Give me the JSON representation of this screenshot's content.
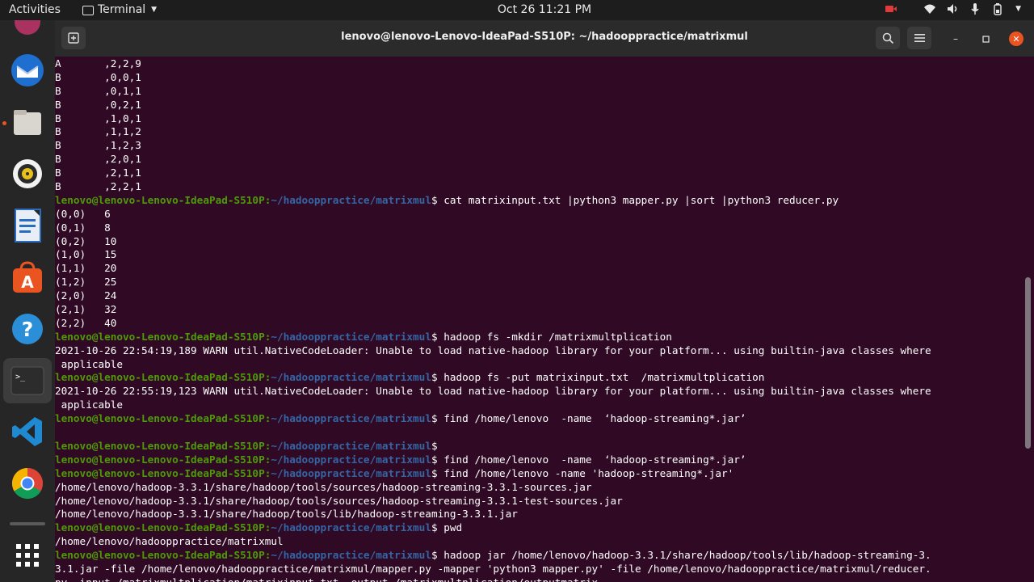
{
  "topbar": {
    "activities": "Activities",
    "app_name": "Terminal",
    "clock": "Oct 26  11:21 PM"
  },
  "dock": {
    "apps": [
      "thunderbird",
      "files",
      "rhythmbox",
      "writer",
      "software",
      "help",
      "terminal",
      "vscode",
      "chrome"
    ]
  },
  "window": {
    "title": "lenovo@lenovo-Lenovo-IdeaPad-S510P: ~/hadooppractice/matrixmul"
  },
  "terminal": {
    "prompt_user": "lenovo@lenovo-Lenovo-IdeaPad-S510P",
    "prompt_path": "~/hadooppractice/matrixmul",
    "prompt_dollar": "$",
    "lines": [
      {
        "type": "out",
        "text": "A       ,2,2,9"
      },
      {
        "type": "out",
        "text": "B       ,0,0,1"
      },
      {
        "type": "out",
        "text": "B       ,0,1,1"
      },
      {
        "type": "out",
        "text": "B       ,0,2,1"
      },
      {
        "type": "out",
        "text": "B       ,1,0,1"
      },
      {
        "type": "out",
        "text": "B       ,1,1,2"
      },
      {
        "type": "out",
        "text": "B       ,1,2,3"
      },
      {
        "type": "out",
        "text": "B       ,2,0,1"
      },
      {
        "type": "out",
        "text": "B       ,2,1,1"
      },
      {
        "type": "out",
        "text": "B       ,2,2,1"
      },
      {
        "type": "cmd",
        "text": " cat matrixinput.txt |python3 mapper.py |sort |python3 reducer.py"
      },
      {
        "type": "out",
        "text": "(0,0)   6"
      },
      {
        "type": "out",
        "text": "(0,1)   8"
      },
      {
        "type": "out",
        "text": "(0,2)   10"
      },
      {
        "type": "out",
        "text": "(1,0)   15"
      },
      {
        "type": "out",
        "text": "(1,1)   20"
      },
      {
        "type": "out",
        "text": "(1,2)   25"
      },
      {
        "type": "out",
        "text": "(2,0)   24"
      },
      {
        "type": "out",
        "text": "(2,1)   32"
      },
      {
        "type": "out",
        "text": "(2,2)   40"
      },
      {
        "type": "cmd",
        "text": " hadoop fs -mkdir /matrixmultplication"
      },
      {
        "type": "out",
        "text": "2021-10-26 22:54:19,189 WARN util.NativeCodeLoader: Unable to load native-hadoop library for your platform... using builtin-java classes where"
      },
      {
        "type": "out",
        "text": " applicable"
      },
      {
        "type": "cmd",
        "text": " hadoop fs -put matrixinput.txt  /matrixmultplication"
      },
      {
        "type": "out",
        "text": "2021-10-26 22:55:19,123 WARN util.NativeCodeLoader: Unable to load native-hadoop library for your platform... using builtin-java classes where"
      },
      {
        "type": "out",
        "text": " applicable"
      },
      {
        "type": "cmd",
        "text": " find /home/lenovo  -name  ‘hadoop-streaming*.jar’"
      },
      {
        "type": "out",
        "text": ""
      },
      {
        "type": "cmd",
        "text": ""
      },
      {
        "type": "cmd",
        "text": " find /home/lenovo  -name  ‘hadoop-streaming*.jar’"
      },
      {
        "type": "cmd",
        "text": " find /home/lenovo -name 'hadoop-streaming*.jar'"
      },
      {
        "type": "out",
        "text": "/home/lenovo/hadoop-3.3.1/share/hadoop/tools/sources/hadoop-streaming-3.3.1-sources.jar"
      },
      {
        "type": "out",
        "text": "/home/lenovo/hadoop-3.3.1/share/hadoop/tools/sources/hadoop-streaming-3.3.1-test-sources.jar"
      },
      {
        "type": "out",
        "text": "/home/lenovo/hadoop-3.3.1/share/hadoop/tools/lib/hadoop-streaming-3.3.1.jar"
      },
      {
        "type": "cmd",
        "text": " pwd"
      },
      {
        "type": "out",
        "text": "/home/lenovo/hadooppractice/matrixmul"
      },
      {
        "type": "cmd",
        "text": " hadoop jar /home/lenovo/hadoop-3.3.1/share/hadoop/tools/lib/hadoop-streaming-3."
      },
      {
        "type": "out",
        "text": "3.1.jar -file /home/lenovo/hadooppractice/matrixmul/mapper.py -mapper 'python3 mapper.py' -file /home/lenovo/hadooppractice/matrixmul/reducer."
      },
      {
        "type": "out",
        "text": "py -input /matrixmultplication/matrixinput.txt -output /matrixmultplication/outputmatrix"
      }
    ]
  }
}
